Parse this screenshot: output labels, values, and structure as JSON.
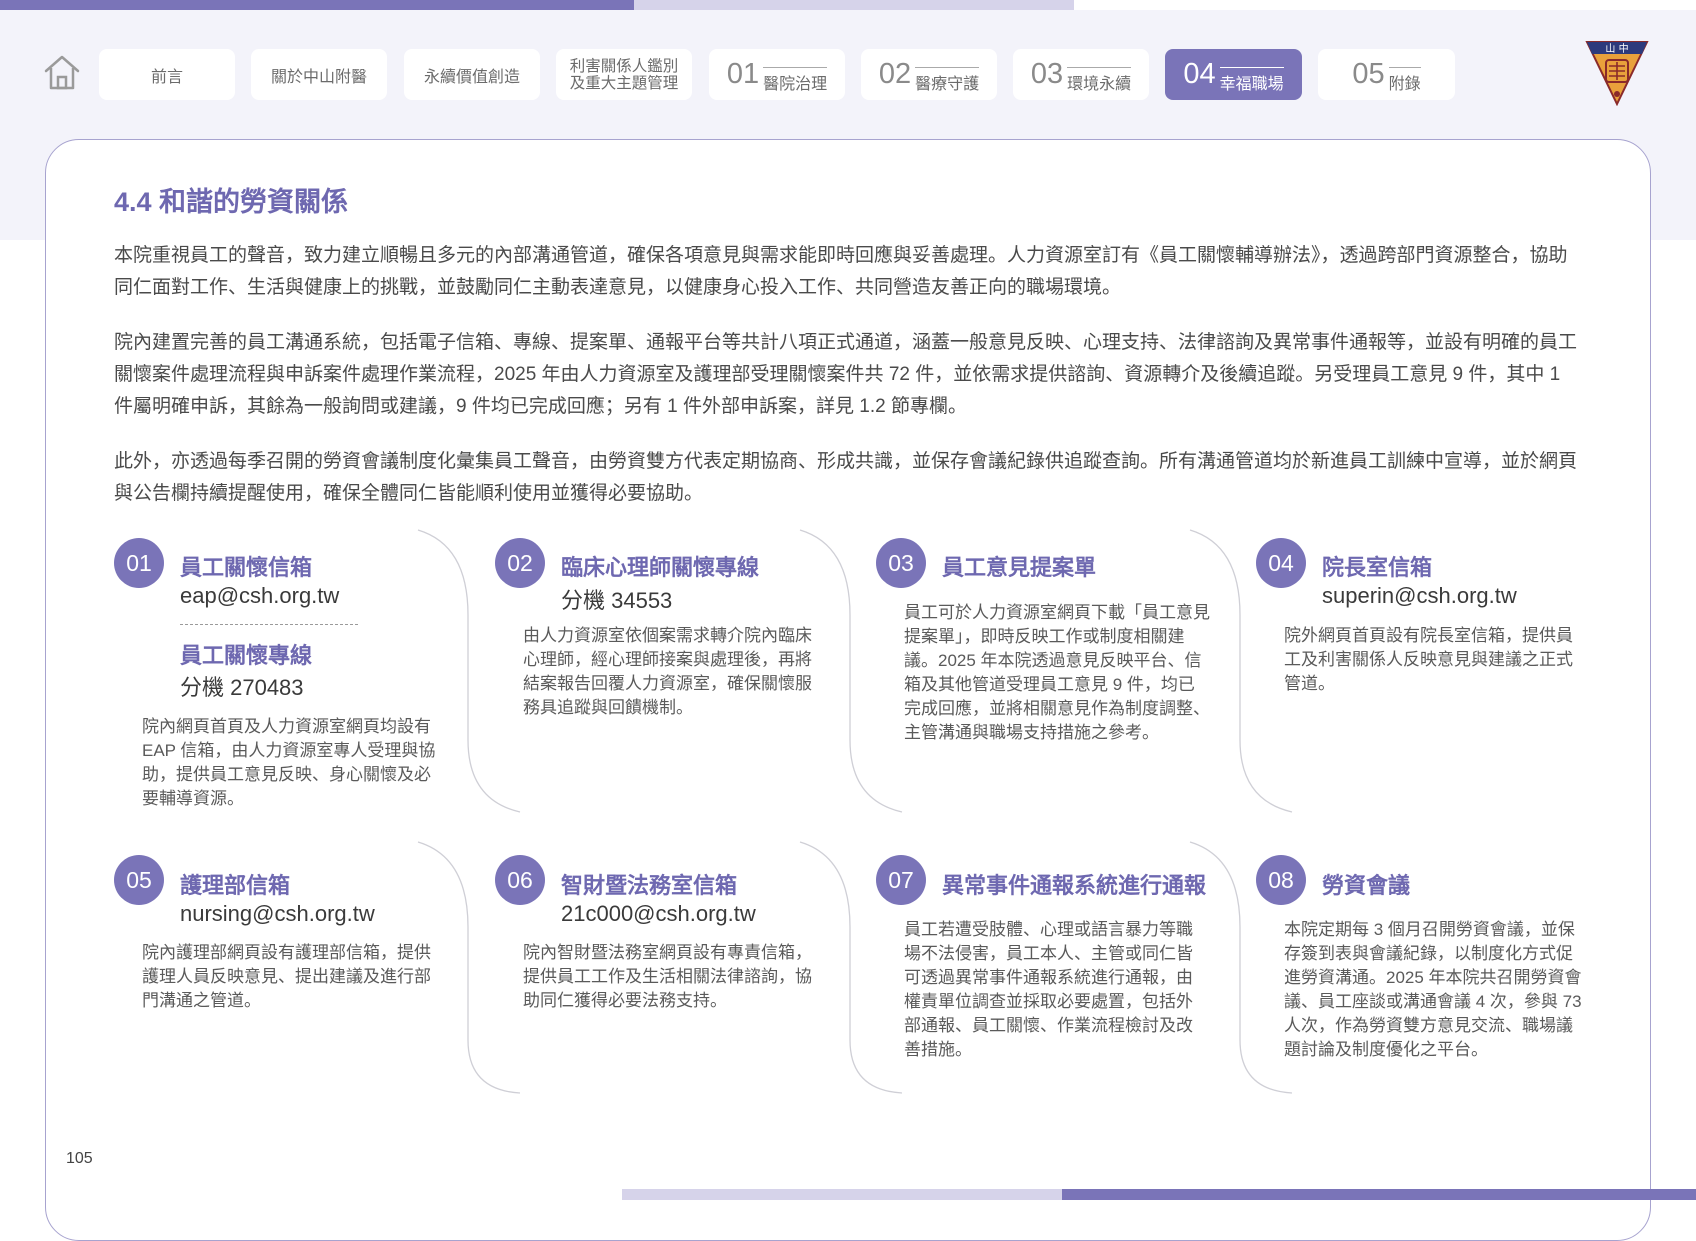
{
  "nav": {
    "items": [
      {
        "label": "前言"
      },
      {
        "label": "關於中山附醫"
      },
      {
        "label": "永續價值創造"
      },
      {
        "label_line1": "利害關係人鑑別",
        "label_line2": "及重大主題管理"
      },
      {
        "num": "01",
        "label": "醫院治理"
      },
      {
        "num": "02",
        "label": "醫療守護"
      },
      {
        "num": "03",
        "label": "環境永續"
      },
      {
        "num": "04",
        "label": "幸福職場"
      },
      {
        "num": "05",
        "label": "附錄"
      }
    ],
    "logo_text": "山中醫"
  },
  "section": {
    "title": "4.4 和諧的勞資關係",
    "paragraphs": [
      "本院重視員工的聲音，致力建立順暢且多元的內部溝通管道，確保各項意見與需求能即時回應與妥善處理。人力資源室訂有《員工關懷輔導辦法》，透過跨部門資源整合，協助同仁面對工作、生活與健康上的挑戰，並鼓勵同仁主動表達意見，以健康身心投入工作、共同營造友善正向的職場環境。",
      "院內建置完善的員工溝通系統，包括電子信箱、專線、提案單、通報平台等共計八項正式通道，涵蓋一般意見反映、心理支持、法律諮詢及異常事件通報等，並設有明確的員工關懷案件處理流程與申訴案件處理作業流程，2025 年由人力資源室及護理部受理關懷案件共 72 件，並依需求提供諮詢、資源轉介及後續追蹤。另受理員工意見 9 件，其中 1 件屬明確申訴，其餘為一般詢問或建議，9 件均已完成回應；另有 1 件外部申訴案，詳見 1.2 節專欄。",
      "此外，亦透過每季召開的勞資會議制度化彙集員工聲音，由勞資雙方代表定期協商、形成共識，並保存會議紀錄供追蹤查詢。所有溝通管道均於新進員工訓練中宣導，並於網頁與公告欄持續提醒使用，確保全體同仁皆能順利使用並獲得必要協助。"
    ]
  },
  "channels": [
    {
      "num": "01",
      "title": "員工關懷信箱",
      "contact": "eap@csh.org.tw",
      "title2": "員工關懷專線",
      "contact2": "分機 270483",
      "desc": "院內網頁首頁及人力資源室網頁均設有 EAP 信箱，由人力資源室專人受理與協助，提供員工意見反映、身心關懷及必要輔導資源。"
    },
    {
      "num": "02",
      "title": "臨床心理師關懷專線",
      "contact": "分機 34553",
      "desc": "由人力資源室依個案需求轉介院內臨床心理師，經心理師接案與處理後，再將結案報告回覆人力資源室，確保關懷服務具追蹤與回饋機制。"
    },
    {
      "num": "03",
      "title": "員工意見提案單",
      "contact": "",
      "desc": "員工可於人力資源室網頁下載「員工意見提案單」，即時反映工作或制度相關建議。2025 年本院透過意見反映平台、信箱及其他管道受理員工意見 9 件，均已完成回應，並將相關意見作為制度調整、主管溝通與職場支持措施之參考。"
    },
    {
      "num": "04",
      "title": "院長室信箱",
      "contact": "superin@csh.org.tw",
      "desc": "院外網頁首頁設有院長室信箱，提供員工及利害關係人反映意見與建議之正式管道。"
    },
    {
      "num": "05",
      "title": "護理部信箱",
      "contact": "nursing@csh.org.tw",
      "desc": "院內護理部網頁設有護理部信箱，提供護理人員反映意見、提出建議及進行部門溝通之管道。"
    },
    {
      "num": "06",
      "title": "智財暨法務室信箱",
      "contact": "21c000@csh.org.tw",
      "desc": "院內智財暨法務室網頁設有專責信箱，提供員工工作及生活相關法律諮詢，協助同仁獲得必要法務支持。"
    },
    {
      "num": "07",
      "title": "異常事件通報系統進行通報",
      "contact": "",
      "desc": "員工若遭受肢體、心理或語言暴力等職場不法侵害，員工本人、主管或同仁皆可透過異常事件通報系統進行通報，由權責單位調查並採取必要處置，包括外部通報、員工關懷、作業流程檢討及改善措施。"
    },
    {
      "num": "08",
      "title": "勞資會議",
      "contact": "",
      "desc": "本院定期每 3 個月召開勞資會議，並保存簽到表與會議紀錄，以制度化方式促進勞資溝通。2025 年本院共召開勞資會議、員工座談或溝通會議 4 次，參與 73 人次，作為勞資雙方意見交流、職場議題討論及制度優化之平台。"
    }
  ],
  "page_number": "105",
  "colors": {
    "accent": "#7a74b8",
    "accent_light": "#d6d3ea",
    "title": "#6e68b0"
  }
}
